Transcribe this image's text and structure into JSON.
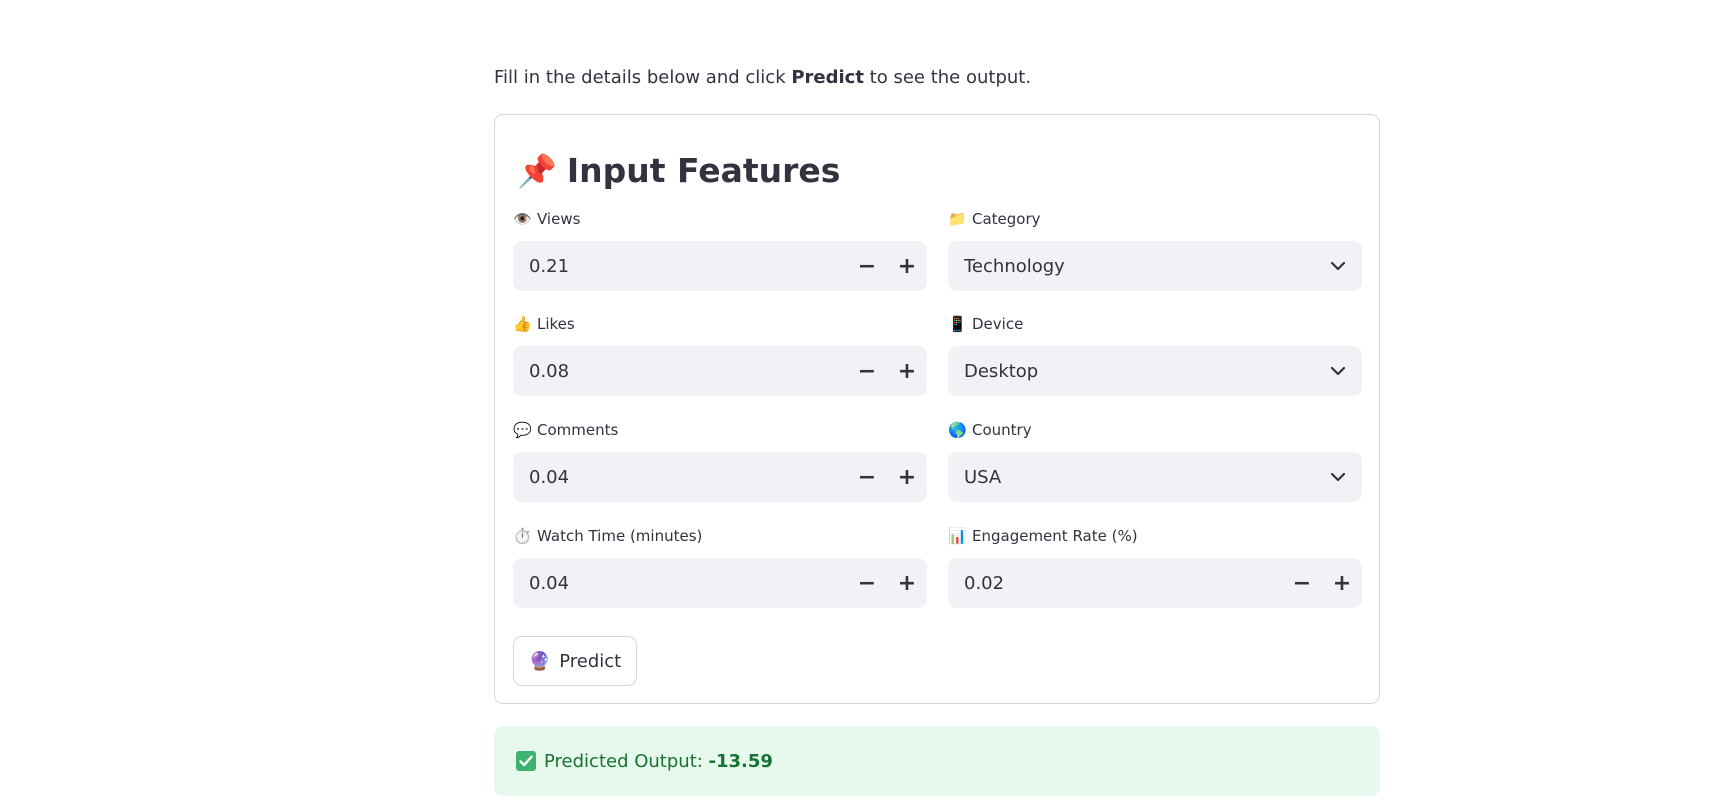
{
  "intro": {
    "before": "Fill in the details below and click ",
    "bold": "Predict",
    "after": " to see the output."
  },
  "form": {
    "title": "Input Features",
    "title_emoji": "📌",
    "fields": {
      "views": {
        "icon": "👁️",
        "label": "Views",
        "value": "0.21"
      },
      "likes": {
        "icon": "👍",
        "label": "Likes",
        "value": "0.08"
      },
      "comments": {
        "icon": "💬",
        "label": "Comments",
        "value": "0.04"
      },
      "watch_time": {
        "icon": "⏱️",
        "label": "Watch Time (minutes)",
        "value": "0.04"
      },
      "category": {
        "icon": "📁",
        "label": "Category",
        "value": "Technology"
      },
      "device": {
        "icon": "📱",
        "label": "Device",
        "value": "Desktop"
      },
      "country": {
        "icon": "🌎",
        "label": "Country",
        "value": "USA"
      },
      "engagement_rate": {
        "icon": "📊",
        "label": "Engagement Rate (%)",
        "value": "0.02"
      }
    },
    "stepper": {
      "minus": "−",
      "plus": "+"
    },
    "predict_button": {
      "icon": "🔮",
      "label": "Predict"
    }
  },
  "result": {
    "label": "Predicted Output: ",
    "value": "-13.59"
  },
  "colors": {
    "result_bg": "#e6f9ec",
    "result_text": "#177233",
    "input_bg": "#f0f2f6",
    "border": "#d6d7db"
  }
}
